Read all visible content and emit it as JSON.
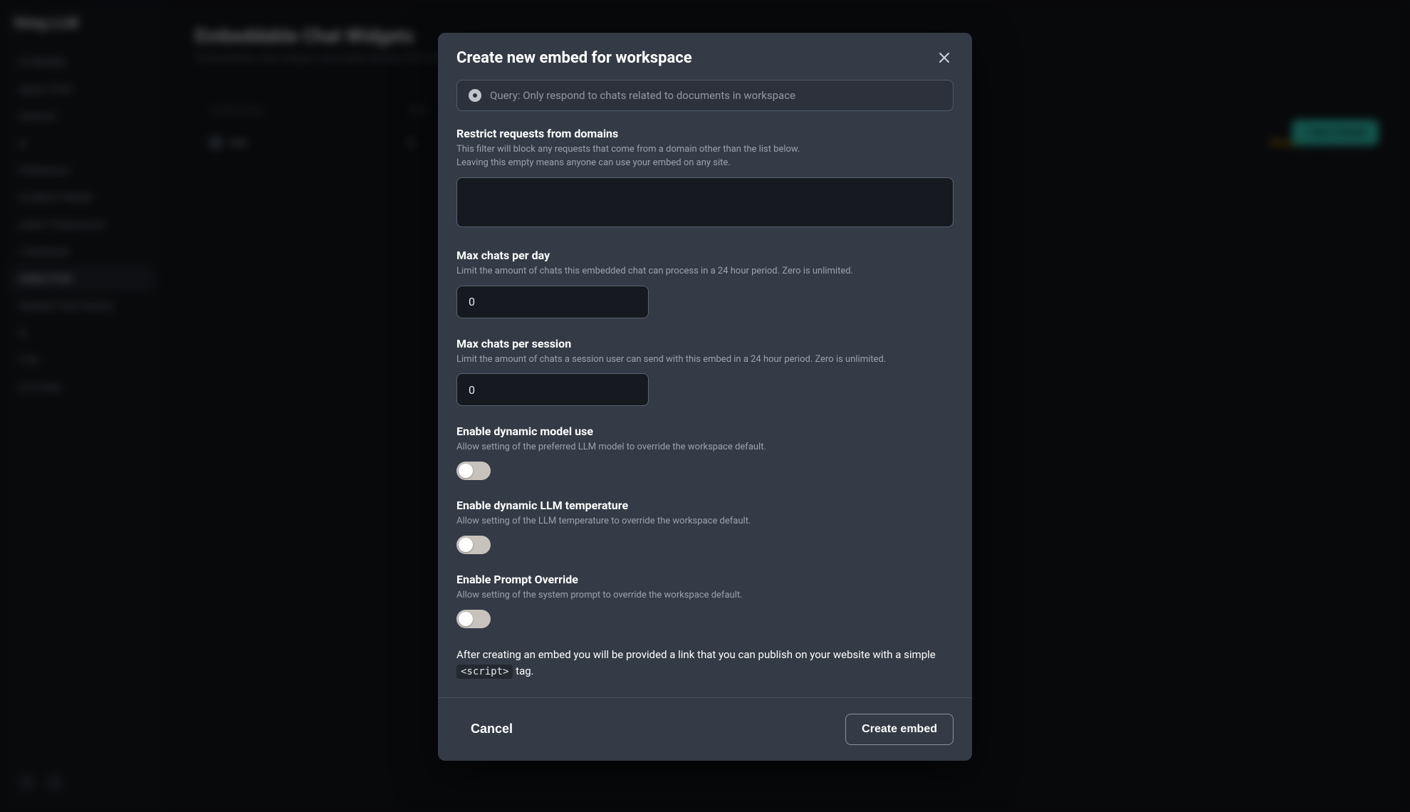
{
  "sidebar": {
    "brand": "thing LLM",
    "items": [
      {
        "label": "AI Models"
      },
      {
        "label": "space Chat"
      },
      {
        "label": "earance"
      },
      {
        "label": "er"
      },
      {
        "label": "Preference"
      },
      {
        "label": "scription Model"
      },
      {
        "label": "udder Preferences"
      },
      {
        "label": "r Database"
      },
      {
        "label": "edded Chat"
      },
      {
        "label": "bedded Chat history"
      },
      {
        "label": "ty"
      },
      {
        "label": "t her"
      },
      {
        "label": "ty & Data"
      }
    ],
    "active_index": 8
  },
  "page": {
    "title": "Embeddable Chat Widgets",
    "subtitle": "Embeddable chat widgets are public-facing chat interfaces...",
    "new_button": "+ New Embed",
    "table": {
      "headers": {
        "workspace": "WORKSPACE",
        "sent": "SENT"
      },
      "rows": [
        {
          "workspace": "test",
          "sent": "0",
          "actions": {
            "disable": "Disable",
            "delete": "Delete"
          }
        }
      ]
    }
  },
  "modal": {
    "title": "Create new embed for workspace",
    "radio_query": "Query: Only respond to chats related to documents in workspace",
    "fields": {
      "domains": {
        "label": "Restrict requests from domains",
        "desc1": "This filter will block any requests that come from a domain other than the list below.",
        "desc2": "Leaving this empty means anyone can use your embed on any site.",
        "value": ""
      },
      "max_day": {
        "label": "Max chats per day",
        "desc": "Limit the amount of chats this embedded chat can process in a 24 hour period. Zero is unlimited.",
        "value": "0"
      },
      "max_session": {
        "label": "Max chats per session",
        "desc": "Limit the amount of chats a session user can send with this embed in a 24 hour period. Zero is unlimited.",
        "value": "0"
      },
      "dyn_model": {
        "label": "Enable dynamic model use",
        "desc": "Allow setting of the preferred LLM model to override the workspace default."
      },
      "dyn_temp": {
        "label": "Enable dynamic LLM temperature",
        "desc": "Allow setting of the LLM temperature to override the workspace default."
      },
      "prompt_override": {
        "label": "Enable Prompt Override",
        "desc": "Allow setting of the system prompt to override the workspace default."
      }
    },
    "after_note_pre": "After creating an embed you will be provided a link that you can publish on your website with a simple ",
    "after_note_code": "<script>",
    "after_note_post": " tag.",
    "buttons": {
      "cancel": "Cancel",
      "create": "Create embed"
    }
  }
}
